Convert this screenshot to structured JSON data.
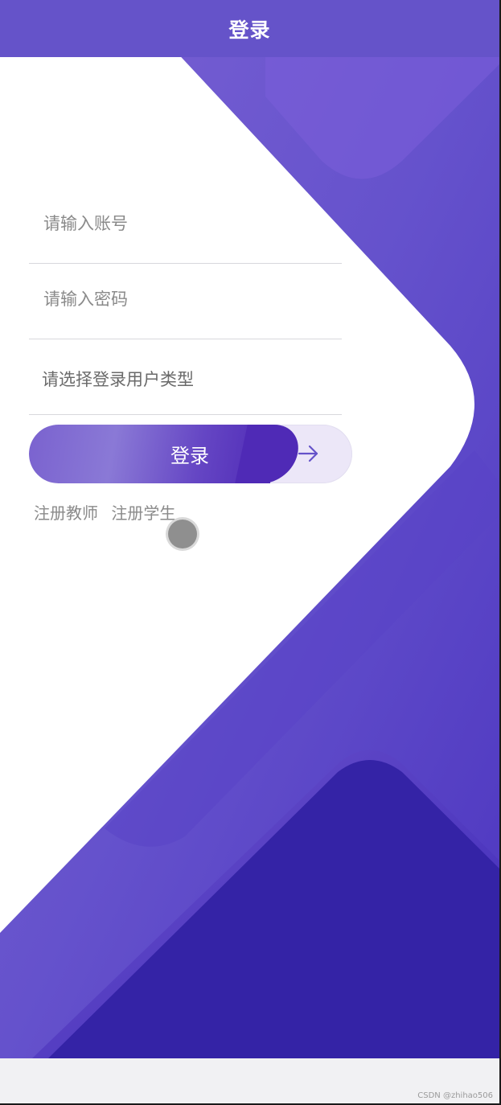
{
  "header": {
    "title": "登录"
  },
  "form": {
    "account_placeholder": "请输入账号",
    "password_placeholder": "请输入密码",
    "user_type_placeholder": "请选择登录用户类型",
    "login_label": "登录",
    "arrow_icon": "arrow-right-icon"
  },
  "links": {
    "register_teacher": "注册教师",
    "register_student": "注册学生"
  },
  "watermark": "CSDN @zhihao506",
  "colors": {
    "primary": "#6553c9",
    "deep_purple": "#3423a6",
    "button_light": "#ece7f8"
  }
}
